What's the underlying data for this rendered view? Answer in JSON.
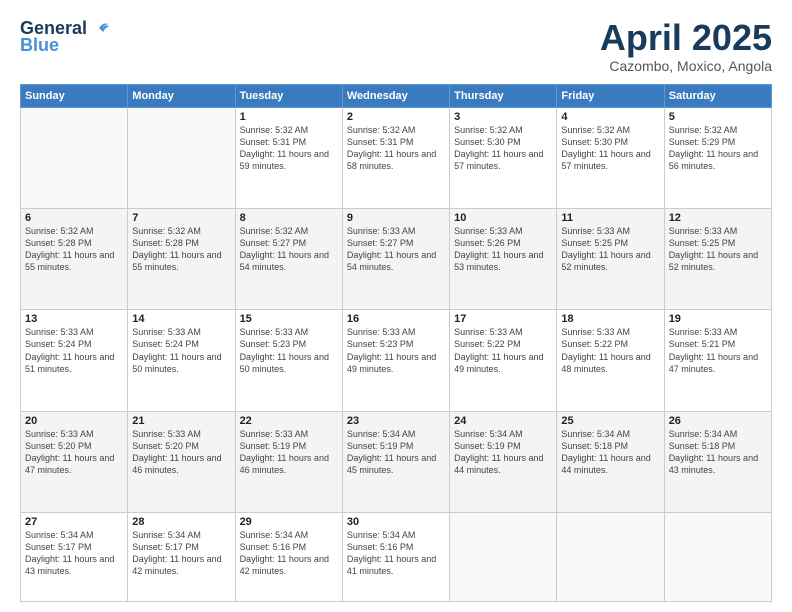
{
  "header": {
    "logo_general": "General",
    "logo_blue": "Blue",
    "month_title": "April 2025",
    "subtitle": "Cazombo, Moxico, Angola"
  },
  "weekdays": [
    "Sunday",
    "Monday",
    "Tuesday",
    "Wednesday",
    "Thursday",
    "Friday",
    "Saturday"
  ],
  "weeks": [
    [
      {
        "day": "",
        "info": ""
      },
      {
        "day": "",
        "info": ""
      },
      {
        "day": "1",
        "info": "Sunrise: 5:32 AM\nSunset: 5:31 PM\nDaylight: 11 hours and 59 minutes."
      },
      {
        "day": "2",
        "info": "Sunrise: 5:32 AM\nSunset: 5:31 PM\nDaylight: 11 hours and 58 minutes."
      },
      {
        "day": "3",
        "info": "Sunrise: 5:32 AM\nSunset: 5:30 PM\nDaylight: 11 hours and 57 minutes."
      },
      {
        "day": "4",
        "info": "Sunrise: 5:32 AM\nSunset: 5:30 PM\nDaylight: 11 hours and 57 minutes."
      },
      {
        "day": "5",
        "info": "Sunrise: 5:32 AM\nSunset: 5:29 PM\nDaylight: 11 hours and 56 minutes."
      }
    ],
    [
      {
        "day": "6",
        "info": "Sunrise: 5:32 AM\nSunset: 5:28 PM\nDaylight: 11 hours and 55 minutes."
      },
      {
        "day": "7",
        "info": "Sunrise: 5:32 AM\nSunset: 5:28 PM\nDaylight: 11 hours and 55 minutes."
      },
      {
        "day": "8",
        "info": "Sunrise: 5:32 AM\nSunset: 5:27 PM\nDaylight: 11 hours and 54 minutes."
      },
      {
        "day": "9",
        "info": "Sunrise: 5:33 AM\nSunset: 5:27 PM\nDaylight: 11 hours and 54 minutes."
      },
      {
        "day": "10",
        "info": "Sunrise: 5:33 AM\nSunset: 5:26 PM\nDaylight: 11 hours and 53 minutes."
      },
      {
        "day": "11",
        "info": "Sunrise: 5:33 AM\nSunset: 5:25 PM\nDaylight: 11 hours and 52 minutes."
      },
      {
        "day": "12",
        "info": "Sunrise: 5:33 AM\nSunset: 5:25 PM\nDaylight: 11 hours and 52 minutes."
      }
    ],
    [
      {
        "day": "13",
        "info": "Sunrise: 5:33 AM\nSunset: 5:24 PM\nDaylight: 11 hours and 51 minutes."
      },
      {
        "day": "14",
        "info": "Sunrise: 5:33 AM\nSunset: 5:24 PM\nDaylight: 11 hours and 50 minutes."
      },
      {
        "day": "15",
        "info": "Sunrise: 5:33 AM\nSunset: 5:23 PM\nDaylight: 11 hours and 50 minutes."
      },
      {
        "day": "16",
        "info": "Sunrise: 5:33 AM\nSunset: 5:23 PM\nDaylight: 11 hours and 49 minutes."
      },
      {
        "day": "17",
        "info": "Sunrise: 5:33 AM\nSunset: 5:22 PM\nDaylight: 11 hours and 49 minutes."
      },
      {
        "day": "18",
        "info": "Sunrise: 5:33 AM\nSunset: 5:22 PM\nDaylight: 11 hours and 48 minutes."
      },
      {
        "day": "19",
        "info": "Sunrise: 5:33 AM\nSunset: 5:21 PM\nDaylight: 11 hours and 47 minutes."
      }
    ],
    [
      {
        "day": "20",
        "info": "Sunrise: 5:33 AM\nSunset: 5:20 PM\nDaylight: 11 hours and 47 minutes."
      },
      {
        "day": "21",
        "info": "Sunrise: 5:33 AM\nSunset: 5:20 PM\nDaylight: 11 hours and 46 minutes."
      },
      {
        "day": "22",
        "info": "Sunrise: 5:33 AM\nSunset: 5:19 PM\nDaylight: 11 hours and 46 minutes."
      },
      {
        "day": "23",
        "info": "Sunrise: 5:34 AM\nSunset: 5:19 PM\nDaylight: 11 hours and 45 minutes."
      },
      {
        "day": "24",
        "info": "Sunrise: 5:34 AM\nSunset: 5:19 PM\nDaylight: 11 hours and 44 minutes."
      },
      {
        "day": "25",
        "info": "Sunrise: 5:34 AM\nSunset: 5:18 PM\nDaylight: 11 hours and 44 minutes."
      },
      {
        "day": "26",
        "info": "Sunrise: 5:34 AM\nSunset: 5:18 PM\nDaylight: 11 hours and 43 minutes."
      }
    ],
    [
      {
        "day": "27",
        "info": "Sunrise: 5:34 AM\nSunset: 5:17 PM\nDaylight: 11 hours and 43 minutes."
      },
      {
        "day": "28",
        "info": "Sunrise: 5:34 AM\nSunset: 5:17 PM\nDaylight: 11 hours and 42 minutes."
      },
      {
        "day": "29",
        "info": "Sunrise: 5:34 AM\nSunset: 5:16 PM\nDaylight: 11 hours and 42 minutes."
      },
      {
        "day": "30",
        "info": "Sunrise: 5:34 AM\nSunset: 5:16 PM\nDaylight: 11 hours and 41 minutes."
      },
      {
        "day": "",
        "info": ""
      },
      {
        "day": "",
        "info": ""
      },
      {
        "day": "",
        "info": ""
      }
    ]
  ]
}
